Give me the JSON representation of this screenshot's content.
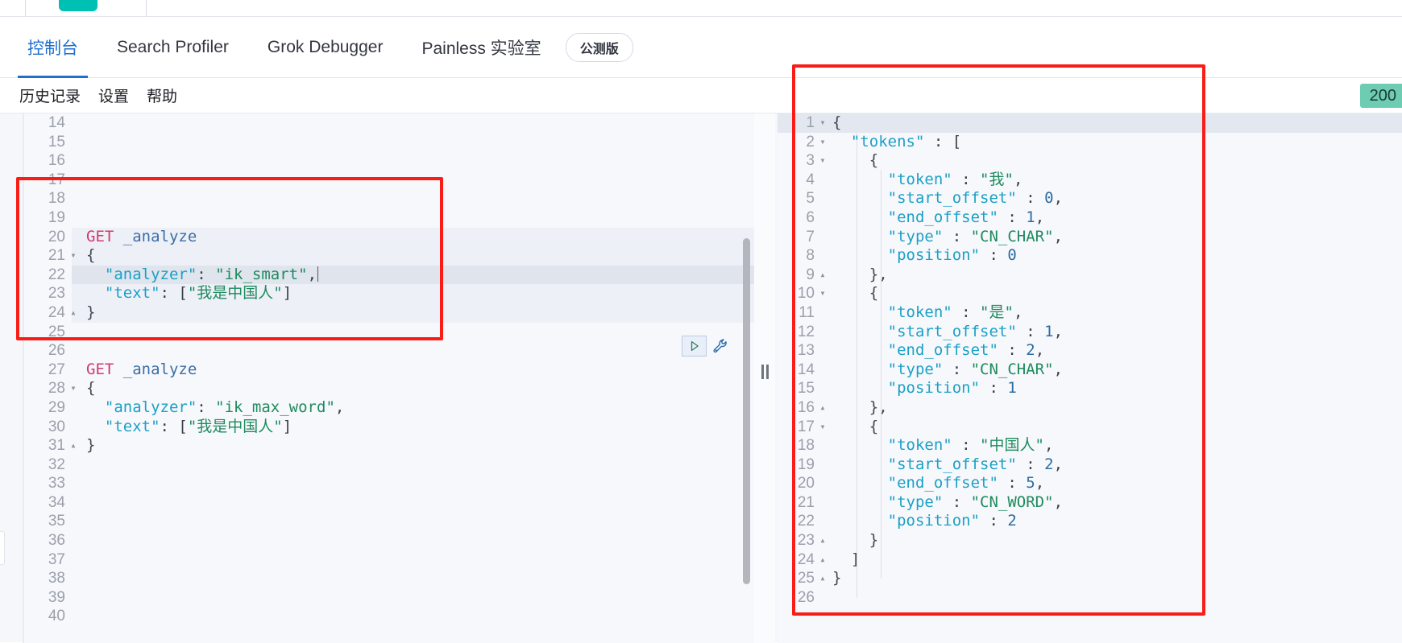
{
  "app": {
    "logo_icon": "elastic-logo-mark"
  },
  "tabbar": {
    "tabs": [
      {
        "label": "控制台",
        "active": true
      },
      {
        "label": "Search Profiler",
        "active": false
      },
      {
        "label": "Grok Debugger",
        "active": false
      },
      {
        "label": "Painless 实验室",
        "active": false
      }
    ],
    "badge": "公测版"
  },
  "menurow": {
    "items": [
      "历史记录",
      "设置",
      "帮助"
    ],
    "status_badge": "200"
  },
  "editor": {
    "run_button_icon": "play-triangle-icon",
    "wrench_button_icon": "wrench-icon",
    "splitter_icon": "vertical-grip-icon",
    "scrollbar_icon": "vertical-scrollbar",
    "request_lines": [
      {
        "n": "14",
        "fold": "",
        "tokens": []
      },
      {
        "n": "15",
        "fold": "",
        "tokens": []
      },
      {
        "n": "16",
        "fold": "",
        "tokens": []
      },
      {
        "n": "17",
        "fold": "",
        "tokens": []
      },
      {
        "n": "18",
        "fold": "",
        "tokens": []
      },
      {
        "n": "19",
        "fold": "",
        "tokens": []
      },
      {
        "n": "20",
        "fold": "",
        "tokens": [
          {
            "t": "GET ",
            "c": "t-method"
          },
          {
            "t": "_analyze",
            "c": "t-url"
          }
        ]
      },
      {
        "n": "21",
        "fold": "▾",
        "tokens": [
          {
            "t": "{",
            "c": "t-brace"
          }
        ]
      },
      {
        "n": "22",
        "fold": "",
        "tokens": [
          {
            "t": "  ",
            "c": "t-plain"
          },
          {
            "t": "\"analyzer\"",
            "c": "t-key"
          },
          {
            "t": ": ",
            "c": "t-punct"
          },
          {
            "t": "\"ik_smart\"",
            "c": "t-str"
          },
          {
            "t": ",",
            "c": "t-punct"
          }
        ],
        "caret": true,
        "cursor": true
      },
      {
        "n": "23",
        "fold": "",
        "tokens": [
          {
            "t": "  ",
            "c": "t-plain"
          },
          {
            "t": "\"text\"",
            "c": "t-key"
          },
          {
            "t": ": [",
            "c": "t-punct"
          },
          {
            "t": "\"我是中国人\"",
            "c": "t-str"
          },
          {
            "t": "]",
            "c": "t-punct"
          }
        ]
      },
      {
        "n": "24",
        "fold": "▴",
        "tokens": [
          {
            "t": "}",
            "c": "t-brace"
          }
        ]
      },
      {
        "n": "25",
        "fold": "",
        "tokens": []
      },
      {
        "n": "26",
        "fold": "",
        "tokens": []
      },
      {
        "n": "27",
        "fold": "",
        "tokens": [
          {
            "t": "GET ",
            "c": "t-method"
          },
          {
            "t": "_analyze",
            "c": "t-url"
          }
        ]
      },
      {
        "n": "28",
        "fold": "▾",
        "tokens": [
          {
            "t": "{",
            "c": "t-brace"
          }
        ]
      },
      {
        "n": "29",
        "fold": "",
        "tokens": [
          {
            "t": "  ",
            "c": "t-plain"
          },
          {
            "t": "\"analyzer\"",
            "c": "t-key"
          },
          {
            "t": ": ",
            "c": "t-punct"
          },
          {
            "t": "\"ik_max_word\"",
            "c": "t-str"
          },
          {
            "t": ",",
            "c": "t-punct"
          }
        ]
      },
      {
        "n": "30",
        "fold": "",
        "tokens": [
          {
            "t": "  ",
            "c": "t-plain"
          },
          {
            "t": "\"text\"",
            "c": "t-key"
          },
          {
            "t": ": [",
            "c": "t-punct"
          },
          {
            "t": "\"我是中国人\"",
            "c": "t-str"
          },
          {
            "t": "]",
            "c": "t-punct"
          }
        ]
      },
      {
        "n": "31",
        "fold": "▴",
        "tokens": [
          {
            "t": "}",
            "c": "t-brace"
          }
        ]
      },
      {
        "n": "32",
        "fold": "",
        "tokens": []
      },
      {
        "n": "33",
        "fold": "",
        "tokens": []
      },
      {
        "n": "34",
        "fold": "",
        "tokens": []
      },
      {
        "n": "35",
        "fold": "",
        "tokens": []
      },
      {
        "n": "36",
        "fold": "",
        "tokens": []
      },
      {
        "n": "37",
        "fold": "",
        "tokens": []
      },
      {
        "n": "38",
        "fold": "",
        "tokens": []
      },
      {
        "n": "39",
        "fold": "",
        "tokens": []
      },
      {
        "n": "40",
        "fold": "",
        "tokens": []
      }
    ],
    "response_lines": [
      {
        "n": "1",
        "fold": "▾",
        "tokens": [
          {
            "t": "{",
            "c": "t-brace"
          }
        ],
        "cursor": true
      },
      {
        "n": "2",
        "fold": "▾",
        "tokens": [
          {
            "t": "  ",
            "c": "t-plain"
          },
          {
            "t": "\"tokens\"",
            "c": "t-key"
          },
          {
            "t": " : [",
            "c": "t-punct"
          }
        ]
      },
      {
        "n": "3",
        "fold": "▾",
        "tokens": [
          {
            "t": "    {",
            "c": "t-brace"
          }
        ]
      },
      {
        "n": "4",
        "fold": "",
        "tokens": [
          {
            "t": "      ",
            "c": "t-plain"
          },
          {
            "t": "\"token\"",
            "c": "t-key"
          },
          {
            "t": " : ",
            "c": "t-punct"
          },
          {
            "t": "\"我\"",
            "c": "t-str"
          },
          {
            "t": ",",
            "c": "t-punct"
          }
        ]
      },
      {
        "n": "5",
        "fold": "",
        "tokens": [
          {
            "t": "      ",
            "c": "t-plain"
          },
          {
            "t": "\"start_offset\"",
            "c": "t-key"
          },
          {
            "t": " : ",
            "c": "t-punct"
          },
          {
            "t": "0",
            "c": "t-num"
          },
          {
            "t": ",",
            "c": "t-punct"
          }
        ]
      },
      {
        "n": "6",
        "fold": "",
        "tokens": [
          {
            "t": "      ",
            "c": "t-plain"
          },
          {
            "t": "\"end_offset\"",
            "c": "t-key"
          },
          {
            "t": " : ",
            "c": "t-punct"
          },
          {
            "t": "1",
            "c": "t-num"
          },
          {
            "t": ",",
            "c": "t-punct"
          }
        ]
      },
      {
        "n": "7",
        "fold": "",
        "tokens": [
          {
            "t": "      ",
            "c": "t-plain"
          },
          {
            "t": "\"type\"",
            "c": "t-key"
          },
          {
            "t": " : ",
            "c": "t-punct"
          },
          {
            "t": "\"CN_CHAR\"",
            "c": "t-str"
          },
          {
            "t": ",",
            "c": "t-punct"
          }
        ]
      },
      {
        "n": "8",
        "fold": "",
        "tokens": [
          {
            "t": "      ",
            "c": "t-plain"
          },
          {
            "t": "\"position\"",
            "c": "t-key"
          },
          {
            "t": " : ",
            "c": "t-punct"
          },
          {
            "t": "0",
            "c": "t-num"
          }
        ]
      },
      {
        "n": "9",
        "fold": "▴",
        "tokens": [
          {
            "t": "    },",
            "c": "t-brace"
          }
        ]
      },
      {
        "n": "10",
        "fold": "▾",
        "tokens": [
          {
            "t": "    {",
            "c": "t-brace"
          }
        ]
      },
      {
        "n": "11",
        "fold": "",
        "tokens": [
          {
            "t": "      ",
            "c": "t-plain"
          },
          {
            "t": "\"token\"",
            "c": "t-key"
          },
          {
            "t": " : ",
            "c": "t-punct"
          },
          {
            "t": "\"是\"",
            "c": "t-str"
          },
          {
            "t": ",",
            "c": "t-punct"
          }
        ]
      },
      {
        "n": "12",
        "fold": "",
        "tokens": [
          {
            "t": "      ",
            "c": "t-plain"
          },
          {
            "t": "\"start_offset\"",
            "c": "t-key"
          },
          {
            "t": " : ",
            "c": "t-punct"
          },
          {
            "t": "1",
            "c": "t-num"
          },
          {
            "t": ",",
            "c": "t-punct"
          }
        ]
      },
      {
        "n": "13",
        "fold": "",
        "tokens": [
          {
            "t": "      ",
            "c": "t-plain"
          },
          {
            "t": "\"end_offset\"",
            "c": "t-key"
          },
          {
            "t": " : ",
            "c": "t-punct"
          },
          {
            "t": "2",
            "c": "t-num"
          },
          {
            "t": ",",
            "c": "t-punct"
          }
        ]
      },
      {
        "n": "14",
        "fold": "",
        "tokens": [
          {
            "t": "      ",
            "c": "t-plain"
          },
          {
            "t": "\"type\"",
            "c": "t-key"
          },
          {
            "t": " : ",
            "c": "t-punct"
          },
          {
            "t": "\"CN_CHAR\"",
            "c": "t-str"
          },
          {
            "t": ",",
            "c": "t-punct"
          }
        ]
      },
      {
        "n": "15",
        "fold": "",
        "tokens": [
          {
            "t": "      ",
            "c": "t-plain"
          },
          {
            "t": "\"position\"",
            "c": "t-key"
          },
          {
            "t": " : ",
            "c": "t-punct"
          },
          {
            "t": "1",
            "c": "t-num"
          }
        ]
      },
      {
        "n": "16",
        "fold": "▴",
        "tokens": [
          {
            "t": "    },",
            "c": "t-brace"
          }
        ]
      },
      {
        "n": "17",
        "fold": "▾",
        "tokens": [
          {
            "t": "    {",
            "c": "t-brace"
          }
        ]
      },
      {
        "n": "18",
        "fold": "",
        "tokens": [
          {
            "t": "      ",
            "c": "t-plain"
          },
          {
            "t": "\"token\"",
            "c": "t-key"
          },
          {
            "t": " : ",
            "c": "t-punct"
          },
          {
            "t": "\"中国人\"",
            "c": "t-str"
          },
          {
            "t": ",",
            "c": "t-punct"
          }
        ]
      },
      {
        "n": "19",
        "fold": "",
        "tokens": [
          {
            "t": "      ",
            "c": "t-plain"
          },
          {
            "t": "\"start_offset\"",
            "c": "t-key"
          },
          {
            "t": " : ",
            "c": "t-punct"
          },
          {
            "t": "2",
            "c": "t-num"
          },
          {
            "t": ",",
            "c": "t-punct"
          }
        ]
      },
      {
        "n": "20",
        "fold": "",
        "tokens": [
          {
            "t": "      ",
            "c": "t-plain"
          },
          {
            "t": "\"end_offset\"",
            "c": "t-key"
          },
          {
            "t": " : ",
            "c": "t-punct"
          },
          {
            "t": "5",
            "c": "t-num"
          },
          {
            "t": ",",
            "c": "t-punct"
          }
        ]
      },
      {
        "n": "21",
        "fold": "",
        "tokens": [
          {
            "t": "      ",
            "c": "t-plain"
          },
          {
            "t": "\"type\"",
            "c": "t-key"
          },
          {
            "t": " : ",
            "c": "t-punct"
          },
          {
            "t": "\"CN_WORD\"",
            "c": "t-str"
          },
          {
            "t": ",",
            "c": "t-punct"
          }
        ]
      },
      {
        "n": "22",
        "fold": "",
        "tokens": [
          {
            "t": "      ",
            "c": "t-plain"
          },
          {
            "t": "\"position\"",
            "c": "t-key"
          },
          {
            "t": " : ",
            "c": "t-punct"
          },
          {
            "t": "2",
            "c": "t-num"
          }
        ]
      },
      {
        "n": "23",
        "fold": "▴",
        "tokens": [
          {
            "t": "    }",
            "c": "t-brace"
          }
        ]
      },
      {
        "n": "24",
        "fold": "▴",
        "tokens": [
          {
            "t": "  ]",
            "c": "t-brace"
          }
        ]
      },
      {
        "n": "25",
        "fold": "▴",
        "tokens": [
          {
            "t": "}",
            "c": "t-brace"
          }
        ]
      },
      {
        "n": "26",
        "fold": "",
        "tokens": []
      }
    ]
  },
  "annotations": {
    "color": "#f91d17",
    "boxes": [
      {
        "name": "request-highlight-box"
      },
      {
        "name": "response-highlight-box"
      }
    ]
  }
}
